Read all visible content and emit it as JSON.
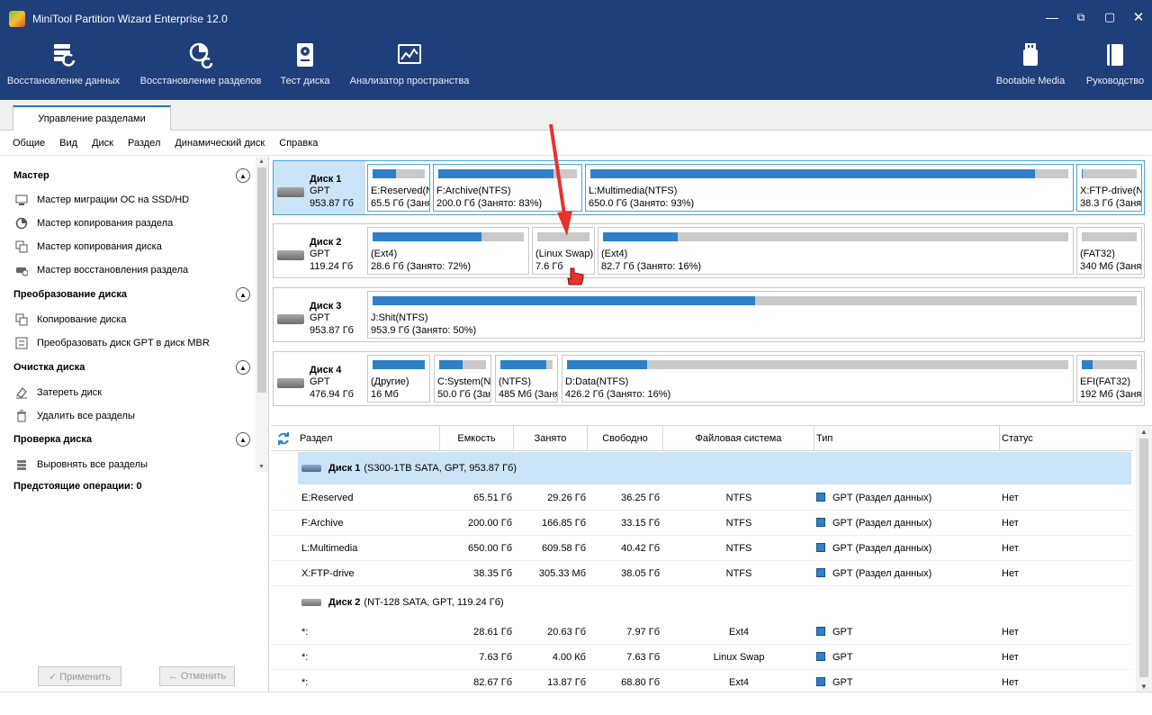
{
  "window": {
    "title": "MiniTool Partition Wizard Enterprise 12.0"
  },
  "toolbar": {
    "data_recovery": "Восстановление данных",
    "partition_recovery": "Восстановление разделов",
    "disk_benchmark": "Тест диска",
    "space_analyzer": "Анализатор пространства",
    "bootable_media": "Bootable Media",
    "manual": "Руководство"
  },
  "tab": {
    "label": "Управление разделами"
  },
  "menu": [
    "Общие",
    "Вид",
    "Диск",
    "Раздел",
    "Динамический диск",
    "Справка"
  ],
  "sidebar": {
    "wizard_title": "Мастер",
    "wizard_items": [
      "Мастер миграции ОС на SSD/HD",
      "Мастер копирования раздела",
      "Мастер копирования диска",
      "Мастер восстановления раздела"
    ],
    "convert_title": "Преобразование диска",
    "convert_items": [
      "Копирование диска",
      "Преобразовать диск GPT в диск MBR"
    ],
    "clean_title": "Очистка диска",
    "clean_items": [
      "Затереть диск",
      "Удалить все разделы"
    ],
    "check_title": "Проверка диска",
    "check_items": [
      "Выровнять все разделы"
    ],
    "pending": "Предстоящие операции: 0",
    "apply": "✓ Применить",
    "undo": "← Отменить"
  },
  "disks": [
    {
      "name": "Диск 1",
      "type": "GPT",
      "size": "953.87 Гб",
      "parts": [
        {
          "l1": "E:Reserved(N",
          "l2": "65.5 Гб (Заня",
          "used": 0.45
        },
        {
          "l1": "F:Archive(NTFS)",
          "l2": "200.0 Гб (Занято: 83%)",
          "used": 0.83
        },
        {
          "l1": "L:Multimedia(NTFS)",
          "l2": "650.0 Гб (Занято: 93%)",
          "used": 0.93
        },
        {
          "l1": "X:FTP-drive(N",
          "l2": "38.3 Гб (Заня",
          "used": 0.01
        }
      ]
    },
    {
      "name": "Диск 2",
      "type": "GPT",
      "size": "119.24 Гб",
      "parts": [
        {
          "l1": "(Ext4)",
          "l2": "28.6 Гб (Занято: 72%)",
          "used": 0.72
        },
        {
          "l1": "(Linux Swap)",
          "l2": "7.6 Гб",
          "used": 0.0
        },
        {
          "l1": "(Ext4)",
          "l2": "82.7 Гб (Занято: 16%)",
          "used": 0.16
        },
        {
          "l1": "(FAT32)",
          "l2": "340 Мб (Заня",
          "used": 0.0
        }
      ]
    },
    {
      "name": "Диск 3",
      "type": "GPT",
      "size": "953.87 Гб",
      "parts": [
        {
          "l1": "J:Shit(NTFS)",
          "l2": "953.9 Гб (Занято: 50%)",
          "used": 0.5
        }
      ]
    },
    {
      "name": "Диск 4",
      "type": "GPT",
      "size": "476.94 Гб",
      "parts": [
        {
          "l1": "(Другие)",
          "l2": "16 Мб",
          "used": 1.0
        },
        {
          "l1": "C:System(N",
          "l2": "50.0 Гб (Заня",
          "used": 0.5
        },
        {
          "l1": "(NTFS)",
          "l2": "485 Мб (Заня",
          "used": 0.88
        },
        {
          "l1": "D:Data(NTFS)",
          "l2": "426.2 Гб (Занято: 16%)",
          "used": 0.16
        },
        {
          "l1": "EFI(FAT32)",
          "l2": "192 Мб (Заня",
          "used": 0.2
        }
      ]
    }
  ],
  "table": {
    "headers": [
      "Раздел",
      "Емкость",
      "Занято",
      "Свободно",
      "Файловая система",
      "Тип",
      "Статус"
    ],
    "disk1": {
      "name": "Диск 1",
      "desc": "(S300-1TB SATA, GPT, 953.87 Гб)"
    },
    "disk2": {
      "name": "Диск 2",
      "desc": "(NT-128 SATA, GPT, 119.24 Гб)"
    },
    "rows1": [
      {
        "name": "E:Reserved",
        "cap": "65.51 Гб",
        "used": "29.26 Гб",
        "free": "36.25 Гб",
        "fs": "NTFS",
        "type": "GPT (Раздел данных)",
        "status": "Нет"
      },
      {
        "name": "F:Archive",
        "cap": "200.00 Гб",
        "used": "166.85 Гб",
        "free": "33.15 Гб",
        "fs": "NTFS",
        "type": "GPT (Раздел данных)",
        "status": "Нет"
      },
      {
        "name": "L:Multimedia",
        "cap": "650.00 Гб",
        "used": "609.58 Гб",
        "free": "40.42 Гб",
        "fs": "NTFS",
        "type": "GPT (Раздел данных)",
        "status": "Нет"
      },
      {
        "name": "X:FTP-drive",
        "cap": "38.35 Гб",
        "used": "305.33 Мб",
        "free": "38.05 Гб",
        "fs": "NTFS",
        "type": "GPT (Раздел данных)",
        "status": "Нет"
      }
    ],
    "rows2": [
      {
        "name": "*:",
        "cap": "28.61 Гб",
        "used": "20.63 Гб",
        "free": "7.97 Гб",
        "fs": "Ext4",
        "type": "GPT",
        "status": "Нет"
      },
      {
        "name": "*:",
        "cap": "7.63 Гб",
        "used": "4.00 Кб",
        "free": "7.63 Гб",
        "fs": "Linux Swap",
        "type": "GPT",
        "status": "Нет"
      },
      {
        "name": "*:",
        "cap": "82.67 Гб",
        "used": "13.87 Гб",
        "free": "68.80 Гб",
        "fs": "Ext4",
        "type": "GPT",
        "status": "Нет"
      }
    ]
  }
}
